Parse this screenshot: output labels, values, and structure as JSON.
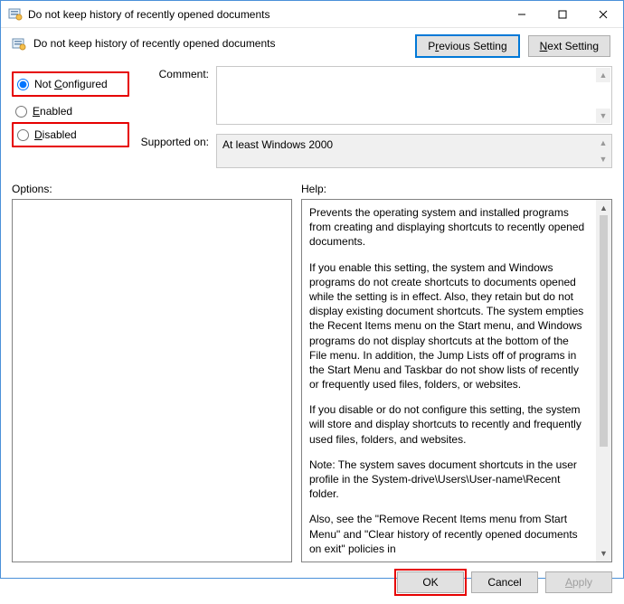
{
  "window": {
    "title": "Do not keep history of recently opened documents"
  },
  "header": {
    "title": "Do not keep history of recently opened documents"
  },
  "nav": {
    "previous": {
      "pre": "P",
      "u": "r",
      "post": "evious Setting"
    },
    "next": {
      "pre": "",
      "u": "N",
      "post": "ext Setting"
    }
  },
  "radios": {
    "not_configured": {
      "pre": "Not ",
      "u": "C",
      "post": "onfigured"
    },
    "enabled": {
      "u": "E",
      "post": "nabled"
    },
    "disabled": {
      "u": "D",
      "post": "isabled"
    }
  },
  "labels": {
    "comment": "Comment:",
    "supported": "Supported on:",
    "options": "Options:",
    "help": "Help:"
  },
  "supported_text": "At least Windows 2000",
  "help": {
    "p1": "Prevents the operating system and installed programs from creating and displaying shortcuts to recently opened documents.",
    "p2": "If you enable this setting, the system and Windows programs do not create shortcuts to documents opened while the setting is in effect. Also, they retain but do not display existing document shortcuts. The system empties the Recent Items menu on the Start menu, and Windows programs do not display shortcuts at the bottom of the File menu. In addition, the Jump Lists off of programs in the Start Menu and Taskbar do not show lists of recently or frequently used files, folders, or websites.",
    "p3": "If you disable or do not configure this setting, the system will store and display shortcuts to recently and frequently used files, folders, and websites.",
    "p4": "Note: The system saves document shortcuts in the user profile in the System-drive\\Users\\User-name\\Recent folder.",
    "p5": "Also, see the \"Remove Recent Items menu from Start Menu\" and \"Clear history of recently opened documents on exit\" policies in"
  },
  "footer": {
    "ok": "OK",
    "cancel": "Cancel",
    "apply": {
      "u": "A",
      "post": "pply"
    }
  }
}
